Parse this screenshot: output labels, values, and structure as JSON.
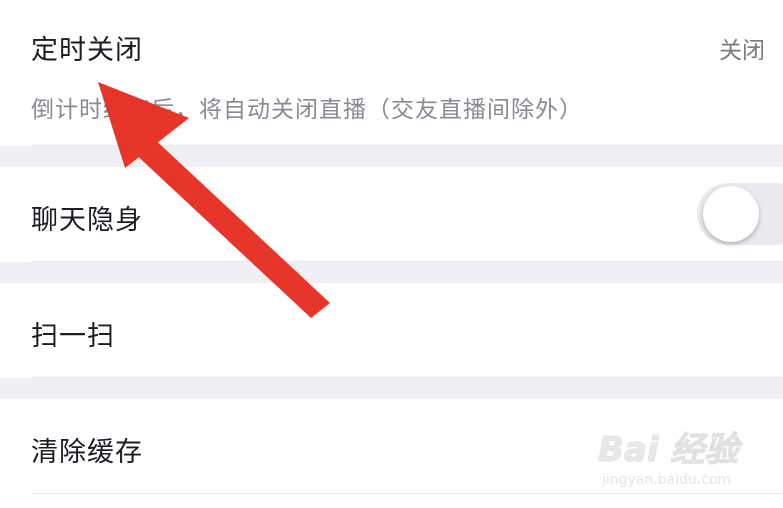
{
  "timer_row": {
    "title": "定时关闭",
    "value": "关闭",
    "description": "倒计时结束后，将自动关闭直播（交友直播间除外）"
  },
  "incognito_row": {
    "title": "聊天隐身",
    "toggle_on": false
  },
  "scan_row": {
    "title": "扫一扫"
  },
  "cache_row": {
    "title": "清除缓存"
  },
  "watermark": {
    "brand": "Bai 经验",
    "url": "jingyan.baidu.com"
  },
  "colors": {
    "gap_background": "#f0f0f4",
    "arrow": "#e8352a",
    "toggle_off": "#e9e9ee"
  },
  "icons": {
    "annotation": "red-arrow-icon"
  }
}
